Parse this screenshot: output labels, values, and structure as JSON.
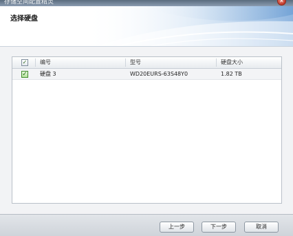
{
  "window": {
    "title": "存储空间配置精灵",
    "close_glyph": "✕"
  },
  "header": {
    "step_title": "选择硬盘"
  },
  "table": {
    "select_all_checked": true,
    "columns": [
      "编号",
      "型号",
      "硬盘大小"
    ],
    "rows": [
      {
        "checked": true,
        "id": "硬盘 3",
        "model": "WD20EURS-63S48Y0",
        "size": "1.82 TB"
      }
    ]
  },
  "footer": {
    "prev_label": "上一步",
    "next_label": "下一步",
    "cancel_label": "取消"
  },
  "colors": {
    "accent": "#4a90d9",
    "checkbox_green": "#3f8b2a",
    "close_red": "#c0392b"
  }
}
